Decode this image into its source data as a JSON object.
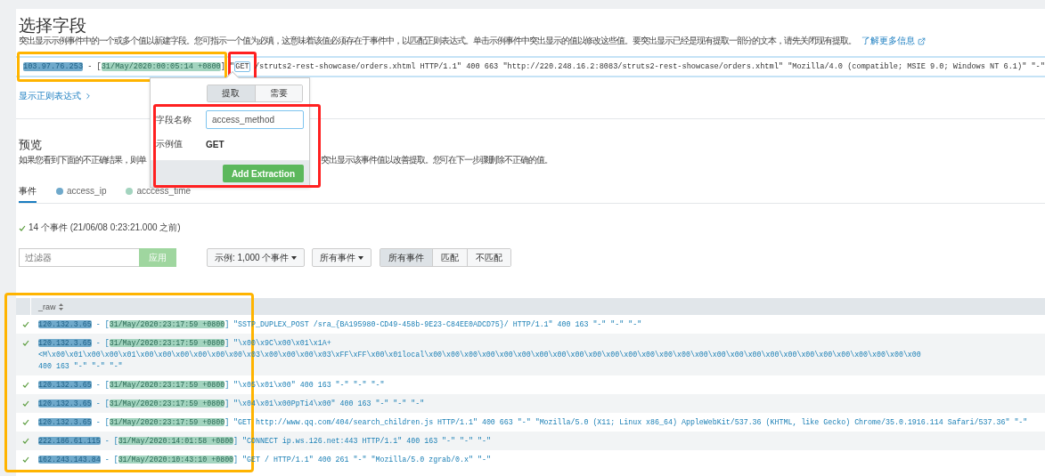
{
  "title": "选择字段",
  "description": "突出显示示例事件中的一个或多个值以新建字段。您可指示一个值为必填，这意味着该值必须存在于事件中，以匹配正则表达式。单击示例事件中突出显示的值以修改这些值。要突出显示已经是现有提取一部分的文本，请先关闭现有提取。",
  "learn_more_link": "了解更多信息",
  "sample": {
    "groups": [
      {
        "frame": {
          "color": "#ffb400"
        },
        "segments": [
          {
            "kind": "ip",
            "text": "103.97.76.253"
          },
          {
            "kind": "plain",
            "text": " - ["
          },
          {
            "kind": "time",
            "text": "31/May/2020:00:05:14 +0800"
          }
        ]
      },
      {
        "segments": [
          {
            "kind": "plain",
            "text": "] \""
          }
        ]
      },
      {
        "frame": {
          "color": "#ff2020"
        },
        "segments": [
          {
            "kind": "method",
            "text": "GET"
          }
        ]
      },
      {
        "segments": [
          {
            "kind": "plain",
            "text": " /struts2-rest-showcase/orders.xhtml HTTP/1.1\" 400 663 \"http://220.248.16.2:8083/struts2-rest-showcase/orders.xhtml\" \"Mozilla/4.0 (compatible; MSIE 9.0; Windows NT 6.1)\" \"-\""
          }
        ]
      }
    ]
  },
  "show_regex_link": "显示正则表达式",
  "popover": {
    "frame": {
      "color": "#ff2020"
    },
    "modes": [
      {
        "label": "提取",
        "selected": true
      },
      {
        "label": "需要",
        "selected": false
      }
    ],
    "field_name_label": "字段名称",
    "field_name_value": "access_method",
    "sample_value_label": "示例值",
    "sample_value": "GET",
    "button": "Add Extraction"
  },
  "preview": {
    "title": "预览",
    "description_parts": [
      "如果您看到下面的不正确结果，则单",
      "突出显示该事件值以改善提取。您可在下一步骤删除不正确的值。"
    ]
  },
  "tabs": [
    {
      "label": "事件",
      "selected": true
    },
    {
      "label": "access_ip",
      "selected": false,
      "color": "#6fa9cb"
    },
    {
      "label": "acccess_time",
      "selected": false,
      "color": "#a3d4bf"
    }
  ],
  "event_count": "14 个事件 (21/06/08 0:23:21.000 之前)",
  "filter": {
    "placeholder": "过滤器",
    "apply": "应用",
    "apply_disabled": true
  },
  "sample_size": "示例: 1,000 个事件",
  "event_scope": "所有事件",
  "match_modes": [
    {
      "label": "所有事件",
      "selected": true
    },
    {
      "label": "匹配",
      "selected": false
    },
    {
      "label": "不匹配",
      "selected": false
    }
  ],
  "table": {
    "frame": {
      "color": "#ffb400"
    },
    "column": "_raw",
    "rows": [
      {
        "checked": true,
        "ip": "120.132.3.65",
        "separator": " - [",
        "time": "31/May/2020:23:17:59 +0800",
        "rest": "] \"SSTP_DUPLEX_POST /sra_{BA195980-CD49-458b-9E23-C84EE0ADCD75}/ HTTP/1.1\" 400 163 \"-\" \"-\" \"-\""
      },
      {
        "checked": true,
        "ip": "120.132.3.65",
        "separator": " - [",
        "time": "31/May/2020:23:17:59 +0800",
        "rest": "] \"\\x00\\x9C\\x00\\x01\\x1A+",
        "more_lines": [
          "<M\\x00\\x01\\x00\\x00\\x01\\x00\\x00\\x00\\x00\\x00\\x00\\x03\\x00\\x00\\x00\\x03\\xFF\\xFF\\x00\\x01local\\x00\\x00\\x00\\x00\\x00\\x00\\x00\\x00\\x00\\x00\\x00\\x00\\x00\\x00\\x00\\x00\\x00\\x00\\x00\\x00\\x00\\x00\\x00\\x00\\x00\\x00\\x00\\x00",
          "400 163 \"-\" \"-\" \"-\""
        ]
      },
      {
        "checked": true,
        "ip": "120.132.3.65",
        "separator": " - [",
        "time": "31/May/2020:23:17:59 +0800",
        "rest": "] \"\\x05\\x01\\x00\" 400 163 \"-\" \"-\" \"-\""
      },
      {
        "checked": true,
        "ip": "120.132.3.65",
        "separator": " - [",
        "time": "31/May/2020:23:17:59 +0800",
        "rest": "] \"\\x04\\x01\\x00PpTi4\\x00\" 400 163 \"-\" \"-\" \"-\""
      },
      {
        "checked": true,
        "ip": "120.132.3.65",
        "separator": " - [",
        "time": "31/May/2020:23:17:59 +0800",
        "rest": "] \"GET http://www.qq.com/404/search_children.js HTTP/1.1\" 400 663 \"-\" \"Mozilla/5.0 (X11; Linux x86_64) AppleWebKit/537.36 (KHTML, like Gecko) Chrome/35.0.1916.114 Safari/537.36\" \"-\""
      },
      {
        "checked": true,
        "ip": "222.186.61.115",
        "separator": " - [",
        "time": "31/May/2020:14:01:58 +0800",
        "rest": "] \"CONNECT ip.ws.126.net:443 HTTP/1.1\" 400 163 \"-\" \"-\" \"-\""
      },
      {
        "checked": true,
        "ip": "162.243.143.84",
        "separator": " - [",
        "time": "31/May/2020:10:43:10 +0800",
        "rest": "] \"GET / HTTP/1.1\" 400 261 \"-\" \"Mozilla/5.0 zgrab/0.x\" \"-\""
      }
    ]
  }
}
